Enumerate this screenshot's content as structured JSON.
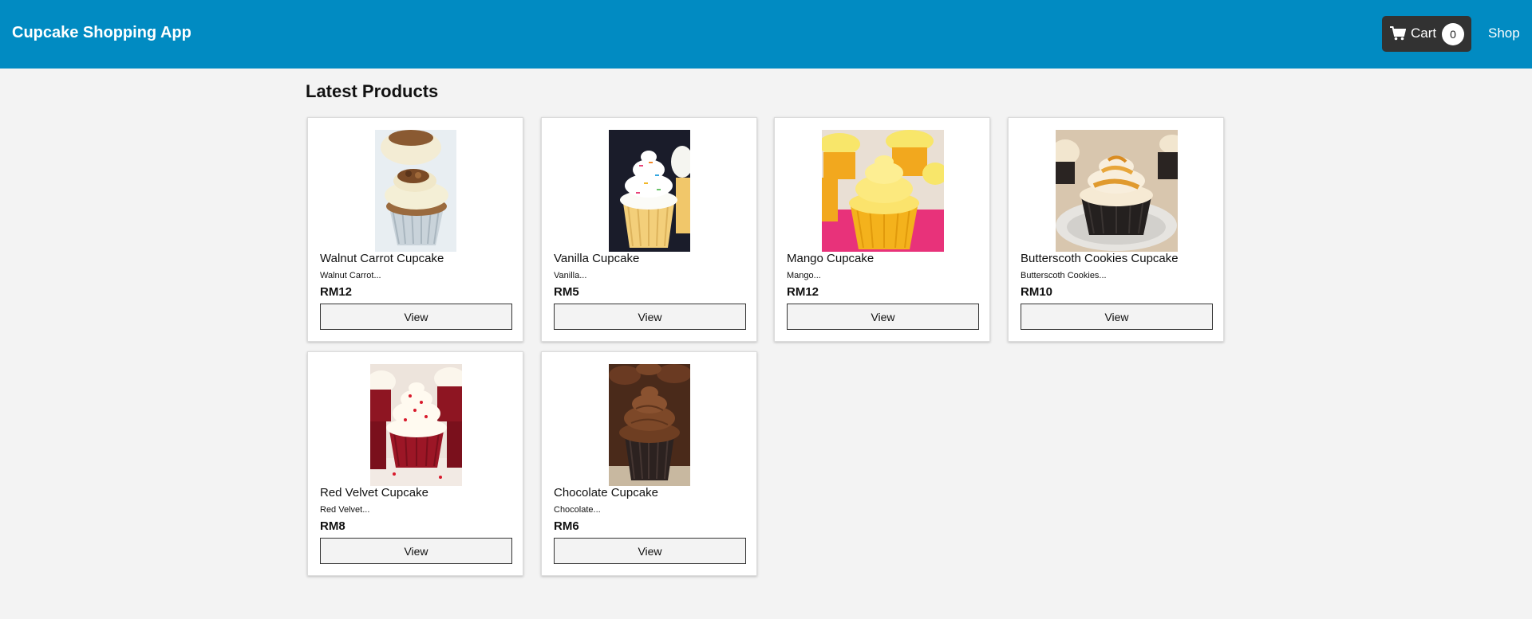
{
  "app": {
    "title": "Cupcake Shopping App"
  },
  "nav": {
    "cart_label": "Cart",
    "cart_count": "0",
    "shop_label": "Shop"
  },
  "main": {
    "heading": "Latest Products"
  },
  "products": [
    {
      "name": "Walnut Carrot Cupcake",
      "desc": "Walnut Carrot...",
      "price": "RM12",
      "view_label": "View"
    },
    {
      "name": "Vanilla Cupcake",
      "desc": "Vanilla...",
      "price": "RM5",
      "view_label": "View"
    },
    {
      "name": "Mango Cupcake",
      "desc": "Mango...",
      "price": "RM12",
      "view_label": "View"
    },
    {
      "name": "Butterscoth Cookies Cupcake",
      "desc": "Butterscoth Cookies...",
      "price": "RM10",
      "view_label": "View"
    },
    {
      "name": "Red Velvet Cupcake",
      "desc": "Red Velvet...",
      "price": "RM8",
      "view_label": "View"
    },
    {
      "name": "Chocolate Cupcake",
      "desc": "Chocolate...",
      "price": "RM6",
      "view_label": "View"
    }
  ],
  "colors": {
    "navbar": "#018bc2",
    "cart_button": "#323232",
    "page_background": "#f3f3f3"
  },
  "icons": {
    "cart": "shopping-cart-icon"
  }
}
